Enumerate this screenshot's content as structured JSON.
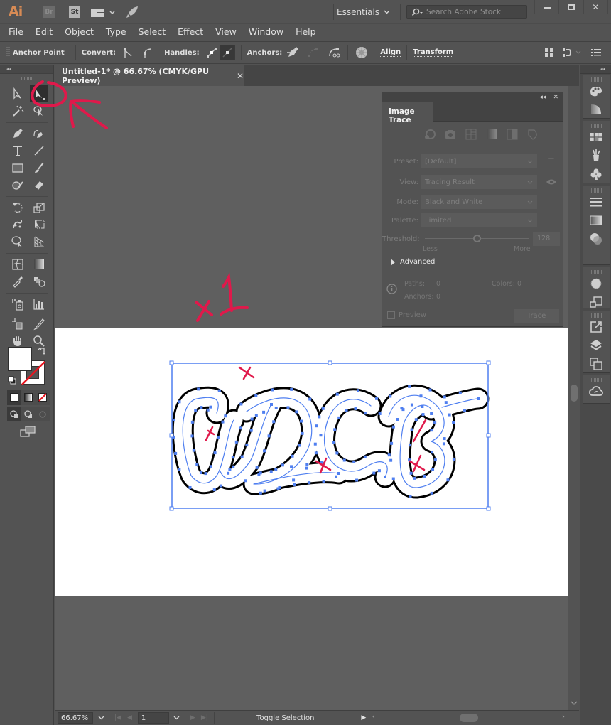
{
  "app": {
    "logo": "Ai",
    "badges": [
      "Br",
      "St"
    ],
    "workspace": "Essentials",
    "search_placeholder": "Search Adobe Stock",
    "window_buttons": [
      "minimize",
      "maximize",
      "close"
    ]
  },
  "menu": [
    "File",
    "Edit",
    "Object",
    "Type",
    "Select",
    "Effect",
    "View",
    "Window",
    "Help"
  ],
  "control_bar": {
    "context_label": "Anchor Point",
    "convert_label": "Convert:",
    "handles_label": "Handles:",
    "anchors_label": "Anchors:",
    "align_link": "Align",
    "transform_link": "Transform"
  },
  "document": {
    "tab_title": "Untitled-1* @ 66.67% (CMYK/GPU Preview)",
    "close_glyph": "✕"
  },
  "toolbar": {
    "collapse_glyph": "◂◂",
    "active_tool": "direct-selection-tool"
  },
  "image_trace": {
    "title": "Image Trace",
    "preset_label": "Preset:",
    "preset_value": "[Default]",
    "view_label": "View:",
    "view_value": "Tracing Result",
    "mode_label": "Mode:",
    "mode_value": "Black and White",
    "palette_label": "Palette:",
    "palette_value": "Limited",
    "threshold_label": "Threshold:",
    "threshold_value": "128",
    "threshold_fraction": 0.5,
    "less_label": "Less",
    "more_label": "More",
    "advanced_label": "Advanced",
    "paths_label": "Paths:",
    "paths_value": "0",
    "colors_label": "Colors:",
    "colors_value": "0",
    "anchors_label": "Anchors:",
    "anchors_value": "0",
    "preview_label": "Preview",
    "preview_checked": false,
    "trace_button": "Trace",
    "collapse_glyph": "◂◂",
    "close_glyph": "✕"
  },
  "status_bar": {
    "zoom": "66.67%",
    "artboard": "1",
    "status_text": "Toggle Selection"
  },
  "annotation": {
    "label": "x 1",
    "color": "#e0194b"
  },
  "colors": {
    "selection_blue": "#4f7ff0",
    "annotation_red": "#e0194b",
    "panel_bg": "#535353",
    "canvas_bg": "#5f5f5f"
  }
}
